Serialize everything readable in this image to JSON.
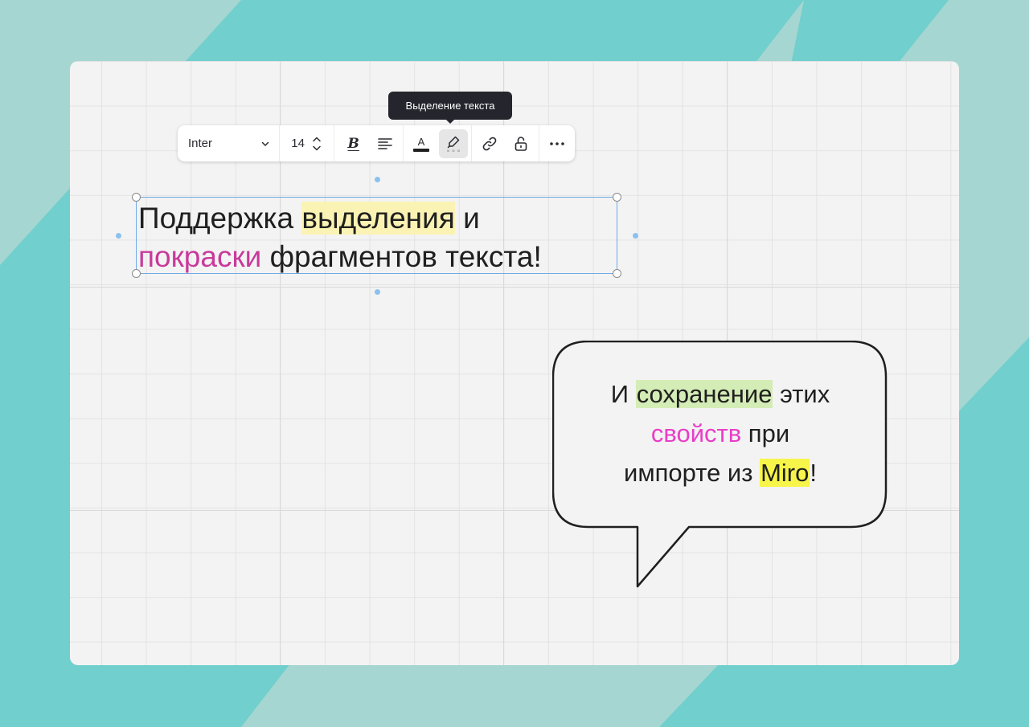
{
  "tooltip": {
    "text": "Выделение текста"
  },
  "toolbar": {
    "font": "Inter",
    "font_size": "14",
    "bold_glyph": "B",
    "text_color_glyph": "A",
    "colors": {
      "text_color_bar": "#1f1f1f"
    },
    "icons": [
      "chevron-down-icon",
      "chevron-up-icon",
      "bold-icon",
      "align-left-icon",
      "text-color-icon",
      "highlighter-icon",
      "link-icon",
      "unlock-icon",
      "more-icon"
    ]
  },
  "text_widget": {
    "line1": {
      "plain_start": "Поддержка ",
      "highlighted": "выделения",
      "plain_end": " и"
    },
    "line2": {
      "colored": "покраски",
      "plain_end": " фрагментов текста!"
    },
    "colors": {
      "highlight": "#fbf3b3",
      "text_color": "#c83a9b"
    }
  },
  "bubble": {
    "line1": {
      "plain_start": "И ",
      "highlighted": "сохранение",
      "plain_end": " этих"
    },
    "line2": {
      "colored": "свойств",
      "plain_end": " при"
    },
    "line3": {
      "plain_start": "импорте из ",
      "highlighted": "Miro",
      "plain_end": "!"
    },
    "colors": {
      "highlight_green": "#d4ecb5",
      "text_pink": "#e83ec7",
      "highlight_yellow": "#f8f54a"
    }
  }
}
